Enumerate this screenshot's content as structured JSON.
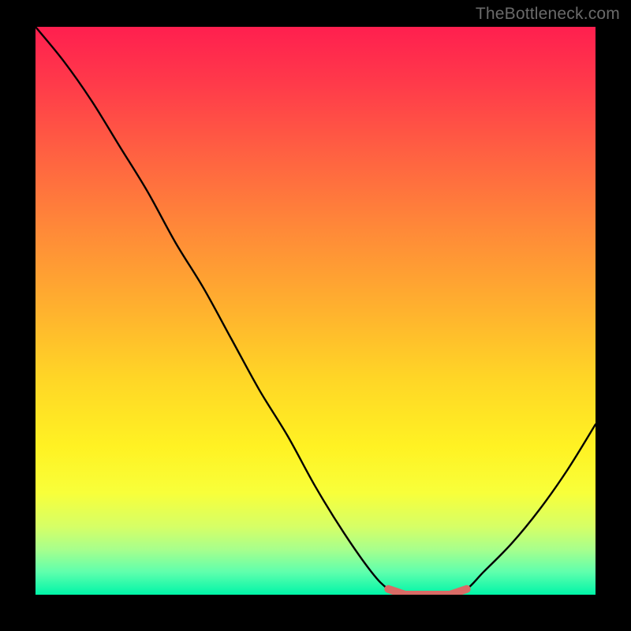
{
  "attribution": "TheBottleneck.com",
  "accent_color": "#d96b66",
  "accent_width": 10,
  "chart_data": {
    "type": "line",
    "title": "",
    "xlabel": "",
    "ylabel": "",
    "xlim": [
      0,
      100
    ],
    "ylim": [
      0,
      100
    ],
    "grid": false,
    "legend": false,
    "series": [
      {
        "name": "bottleneck-curve",
        "x": [
          0,
          5,
          10,
          15,
          20,
          25,
          30,
          35,
          40,
          45,
          50,
          55,
          60,
          63,
          66,
          70,
          74,
          77,
          80,
          85,
          90,
          95,
          100
        ],
        "y": [
          100,
          94,
          87,
          79,
          71,
          62,
          54,
          45,
          36,
          28,
          19,
          11,
          4,
          1,
          0,
          0,
          0,
          1,
          4,
          9,
          15,
          22,
          30
        ]
      }
    ],
    "optimal_range": {
      "x_start": 63,
      "x_end": 77
    },
    "annotations": []
  }
}
